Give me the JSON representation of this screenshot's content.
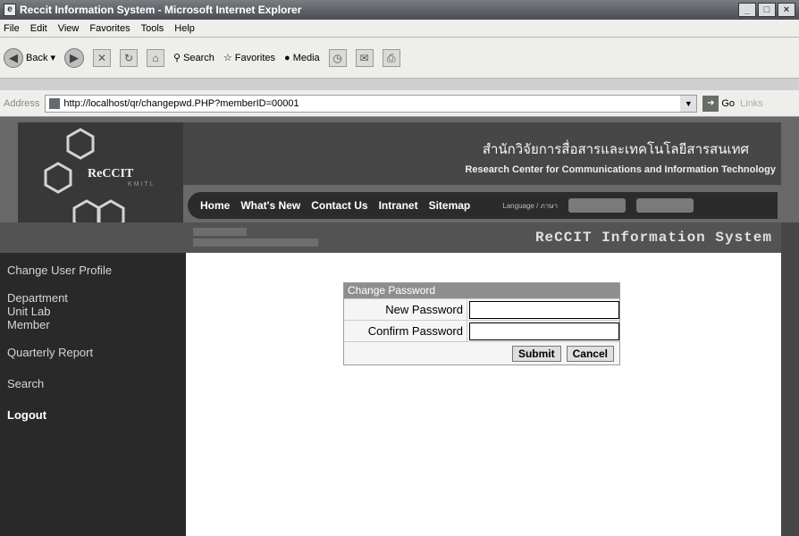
{
  "window": {
    "title": "Reccit Information System - Microsoft Internet Explorer",
    "minimize_glyph": "_",
    "maximize_glyph": "□",
    "close_glyph": "×"
  },
  "menu": {
    "items": [
      "File",
      "Edit",
      "View",
      "Favorites",
      "Tools",
      "Help"
    ]
  },
  "toolbar": {
    "back_label": "Back",
    "search_label": "Search",
    "favorites_label": "Favorites",
    "media_label": "Media"
  },
  "address": {
    "label": "Address",
    "url": "http://localhost/qr/changepwd.PHP?memberID=00001",
    "go_label": "Go",
    "links_label": "Links"
  },
  "site": {
    "logo": "ReCCIT",
    "logo_sub": "KMITL",
    "thai_title": "สำนักวิจัยการสื่อสารและเทคโนโลยีสารสนเทศ",
    "eng_title": "Research Center for Communications and Information Technology",
    "nav": [
      "Home",
      "What's New",
      "Contact Us",
      "Intranet",
      "Sitemap"
    ],
    "language_label": "Language / ภาษา",
    "system_title": "ReCCIT Information System"
  },
  "sidebar": {
    "items": [
      {
        "label": "Change User Profile"
      },
      {
        "label": "Department"
      },
      {
        "label": "Unit Lab"
      },
      {
        "label": "Member"
      },
      {
        "label": "Quarterly Report"
      },
      {
        "label": "Search"
      },
      {
        "label": "Logout"
      }
    ]
  },
  "form": {
    "header": "Change Password",
    "new_password_label": "New Password",
    "new_password_value": "",
    "confirm_password_label": "Confirm Password",
    "confirm_password_value": "",
    "submit_label": "Submit",
    "cancel_label": "Cancel"
  }
}
